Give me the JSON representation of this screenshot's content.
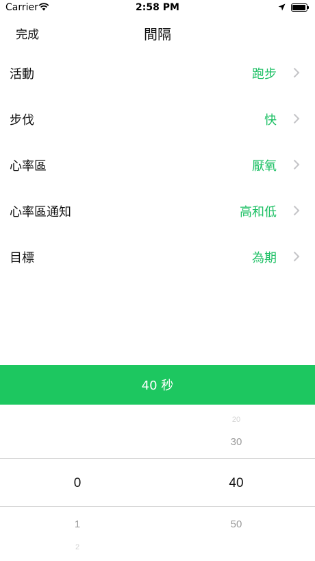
{
  "status_bar": {
    "carrier": "Carrier",
    "time": "2:58 PM"
  },
  "nav": {
    "done_label": "完成",
    "title": "間隔"
  },
  "rows": [
    {
      "label": "活動",
      "value": "跑步"
    },
    {
      "label": "步伐",
      "value": "快"
    },
    {
      "label": "心率區",
      "value": "厭氧"
    },
    {
      "label": "心率區通知",
      "value": "高和低"
    },
    {
      "label": "目標",
      "value": "為期"
    }
  ],
  "value_bar": {
    "text": "40 秒"
  },
  "picker": {
    "left": {
      "far_above": "",
      "above": "",
      "selected": "0",
      "below": "1",
      "far_below": "2"
    },
    "right": {
      "far_above": "20",
      "above": "30",
      "selected": "40",
      "below": "50",
      "far_below": ""
    }
  },
  "colors": {
    "accent": "#1ec065",
    "bar": "#1dc760"
  }
}
